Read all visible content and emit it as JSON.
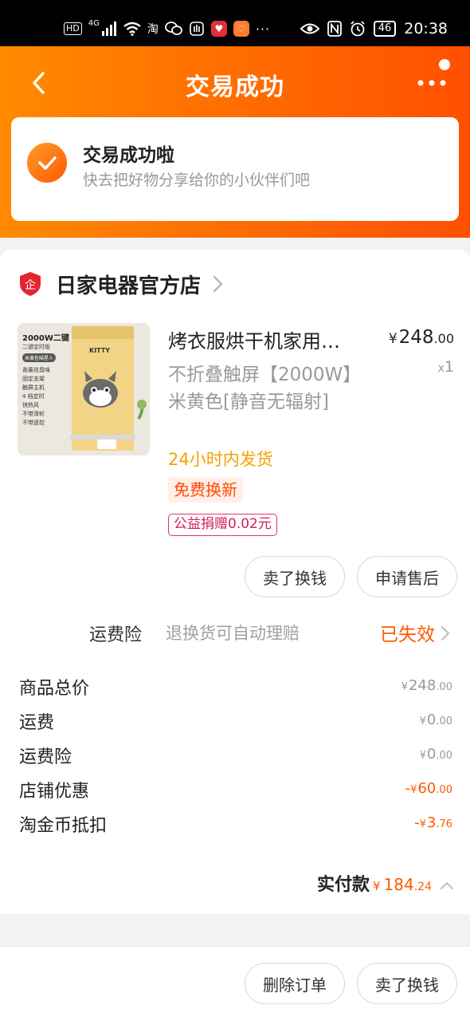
{
  "status_bar": {
    "hd": "HD",
    "net": "4G",
    "taobao_glyph": "淘",
    "icons": [
      "signal-icon",
      "wifi-icon",
      "taobao-icon",
      "wechat-icon",
      "hand-icon",
      "heart-app-icon",
      "health-app-icon",
      "more-dots-icon",
      "eye-icon",
      "nfc-icon",
      "alarm-icon"
    ],
    "battery": "46",
    "time": "20:38"
  },
  "header": {
    "title": "交易成功"
  },
  "success": {
    "title": "交易成功啦",
    "subtitle": "快去把好物分享给你的小伙伴们吧"
  },
  "shop": {
    "logo_text": "企",
    "name": "日家电器官方店"
  },
  "product": {
    "title": "烤衣服烘干机家用…",
    "price_currency": "¥",
    "price_int": "248",
    "price_dec": ".00",
    "qty_x": "x",
    "qty": "1",
    "sku": "不折叠触屏【2000W】米黄色[静音无辐射]",
    "shipping": "24小时内发货",
    "tag_exchange": "免费换新",
    "tag_charity": "公益捐赠0.02元",
    "image": {
      "headline": "2000W二键",
      "subhead": "二键定时版",
      "color_tag": "米黄色喵星人",
      "brand": "KITTY",
      "features": [
        "香薰祛臭味",
        "固定支架",
        "触屏主机",
        "4 档定时",
        "快热风",
        "不带滑轮",
        "不带遥控"
      ]
    }
  },
  "buttons": {
    "sell_for_cash": "卖了换钱",
    "apply_after_sale": "申请售后",
    "delete_order": "删除订单",
    "sell_for_cash_bottom": "卖了换钱"
  },
  "insurance": {
    "label": "运费险",
    "desc": "退换货可自动理赔",
    "status": "已失效"
  },
  "fees": [
    {
      "label": "商品总价",
      "prefix": "",
      "currency": "¥",
      "int": "248",
      "dec": ".00",
      "highlight": false
    },
    {
      "label": "运费",
      "prefix": "",
      "currency": "¥",
      "int": "0",
      "dec": ".00",
      "highlight": false
    },
    {
      "label": "运费险",
      "prefix": "",
      "currency": "¥",
      "int": "0",
      "dec": ".00",
      "highlight": false
    },
    {
      "label": "店铺优惠",
      "prefix": "-",
      "currency": "¥",
      "int": "60",
      "dec": ".00",
      "highlight": true
    },
    {
      "label": "淘金币抵扣",
      "prefix": "-",
      "currency": "¥",
      "int": "3",
      "dec": ".76",
      "highlight": true
    }
  ],
  "total": {
    "label": "实付款",
    "currency": "¥",
    "int": "184",
    "dec": ".24"
  },
  "colors": {
    "brand_orange": "#ff6a00",
    "price_orange": "#ff5a00",
    "shipping_yellow": "#f5a000",
    "charity_pink": "#d0205a"
  }
}
